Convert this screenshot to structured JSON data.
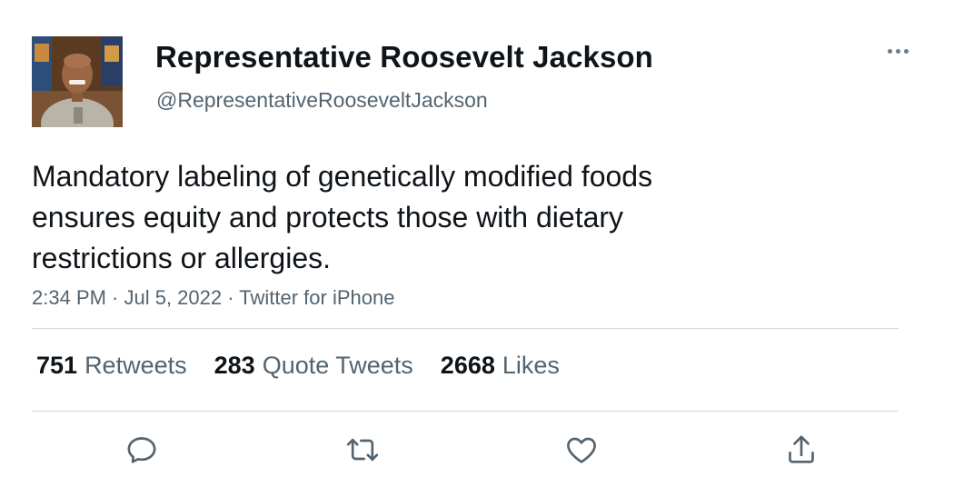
{
  "author": {
    "display_name": "Representative Roosevelt Jackson",
    "handle": "@RepresentativeRooseveltJackson"
  },
  "tweet": {
    "text_lines": [
      "Mandatory labeling of genetically modified foods",
      "ensures equity and protects those with dietary",
      "restrictions or allergies."
    ],
    "meta": "2:34 PM · Jul 5, 2022 · Twitter for iPhone"
  },
  "stats": {
    "retweets_count": "751",
    "retweets_label": "Retweets",
    "quotes_count": "283",
    "quotes_label": "Quote Tweets",
    "likes_count": "2668",
    "likes_label": "Likes"
  },
  "icons": {
    "more": "more-horizontal-icon",
    "reply": "reply-icon",
    "retweet": "retweet-icon",
    "like": "heart-icon",
    "share": "share-icon"
  },
  "colors": {
    "text_primary": "#0f1419",
    "text_secondary": "#536471",
    "divider": "#cfd9de",
    "icon": "#536471"
  }
}
